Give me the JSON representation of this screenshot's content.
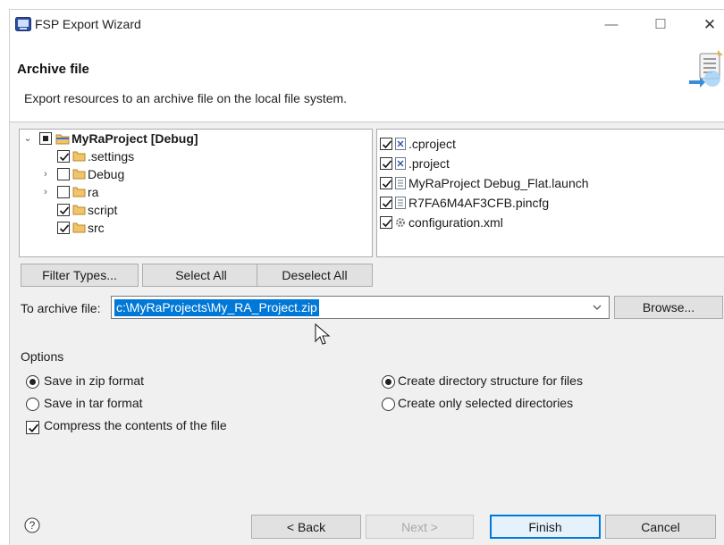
{
  "window": {
    "title": "FSP Export Wizard"
  },
  "header": {
    "title": "Archive file",
    "description": "Export resources to an archive file on the local file system."
  },
  "tree": {
    "root": {
      "label": "MyRaProject [Debug]",
      "state": "partial",
      "expanded": true
    },
    "items": [
      {
        "label": ".settings",
        "checked": true,
        "expandable": false
      },
      {
        "label": "Debug",
        "checked": false,
        "expandable": true
      },
      {
        "label": "ra",
        "checked": false,
        "expandable": true
      },
      {
        "label": "script",
        "checked": true,
        "expandable": false
      },
      {
        "label": "src",
        "checked": true,
        "expandable": false
      }
    ]
  },
  "files": [
    {
      "label": ".cproject",
      "checked": true,
      "icon": "xml-file-icon"
    },
    {
      "label": ".project",
      "checked": true,
      "icon": "xml-file-icon"
    },
    {
      "label": "MyRaProject Debug_Flat.launch",
      "checked": true,
      "icon": "text-file-icon"
    },
    {
      "label": "R7FA6M4AF3CFB.pincfg",
      "checked": true,
      "icon": "text-file-icon"
    },
    {
      "label": "configuration.xml",
      "checked": true,
      "icon": "gear-file-icon"
    }
  ],
  "selection_buttons": {
    "filter": "Filter Types...",
    "select_all": "Select All",
    "deselect_all": "Deselect All"
  },
  "archive": {
    "label": "To archive file:",
    "value": "c:\\MyRaProjects\\My_RA_Project.zip",
    "browse": "Browse..."
  },
  "options": {
    "group_label": "Options",
    "zip": {
      "label": "Save in zip format",
      "selected": true
    },
    "tar": {
      "label": "Save in tar format",
      "selected": false
    },
    "compress": {
      "label": "Compress the contents of the file",
      "checked": true
    },
    "create_structure": {
      "label": "Create directory structure for files",
      "selected": true
    },
    "create_selected": {
      "label": "Create only selected directories",
      "selected": false
    }
  },
  "footer": {
    "back": "< Back",
    "next": "Next >",
    "finish": "Finish",
    "cancel": "Cancel"
  },
  "colors": {
    "accent": "#0078d7",
    "folder": "#e8a33d"
  }
}
